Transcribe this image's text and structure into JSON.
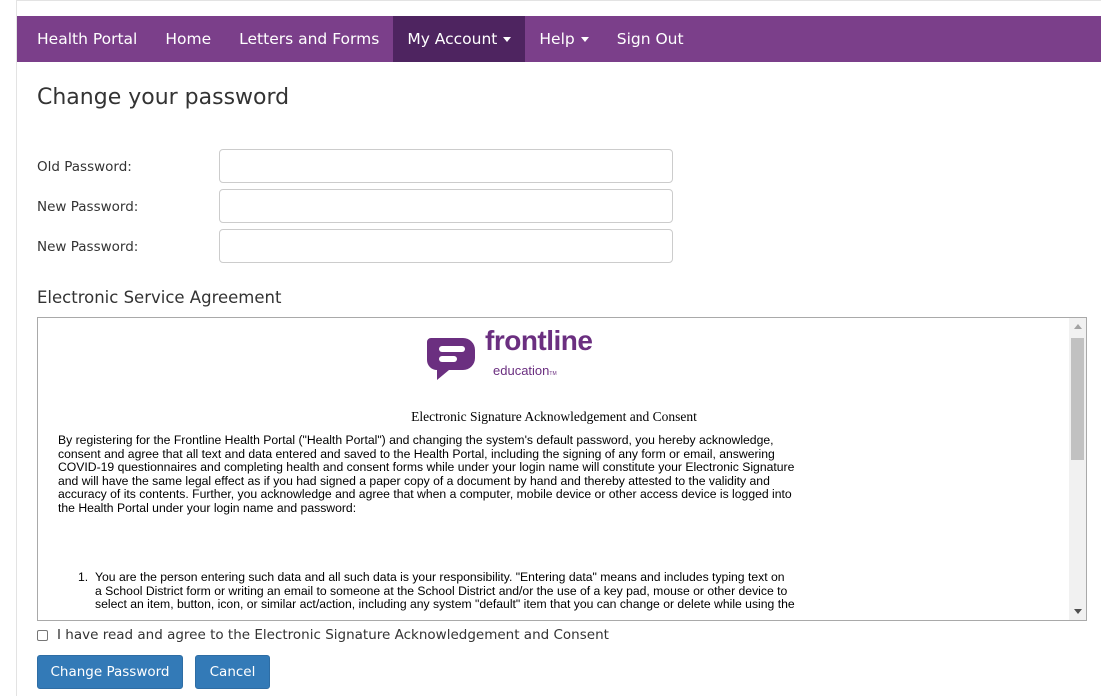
{
  "navbar": {
    "brand": "Health Portal",
    "items": [
      {
        "label": "Home"
      },
      {
        "label": "Letters and Forms"
      },
      {
        "label": "My Account"
      },
      {
        "label": "Help"
      },
      {
        "label": "Sign Out"
      }
    ],
    "color": "#7b3f8a",
    "active_color": "#4e2460"
  },
  "page": {
    "title": "Change your password"
  },
  "form": {
    "old_password_label": "Old Password:",
    "new_password_label": "New Password:",
    "confirm_password_label": "New Password:",
    "old_password_value": "",
    "new_password_value": "",
    "confirm_password_value": ""
  },
  "agreement": {
    "section_title": "Electronic Service Agreement",
    "logo_word": "frontline",
    "logo_sub": "education",
    "logo_tm": "TM",
    "logo_color": "#6b2f80",
    "heading": "Electronic Signature Acknowledgement and Consent",
    "paragraph_lines": [
      "By registering for the Frontline Health Portal (\"Health Portal\") and changing the system's default password, you hereby acknowledge,",
      "consent and agree that all text and data entered and saved to the Health Portal, including the signing of any form or email, answering",
      "COVID-19 questionnaires and completing health and consent forms while under your login name will constitute your Electronic Signature",
      "and will have the same legal effect as if you had signed a paper copy of a document by hand and thereby attested to the validity and",
      "accuracy of its contents. Further, you acknowledge and agree that when a computer, mobile device or other access device is logged into",
      "the Health Portal under your login name and password:"
    ],
    "list_item_number": "1.",
    "list_item_lines": [
      "You are the person entering such data and all such data is your responsibility.  \"Entering data\" means and includes typing text on",
      "a School District form or writing an email to someone at the School District and/or the use of a key pad, mouse or other device to",
      "select an item, button, icon, or similar act/action, including any system \"default\" item that you can change or delete while using the"
    ]
  },
  "consent": {
    "label": "I have read and agree to the Electronic Signature Acknowledgement and Consent",
    "checked": false
  },
  "buttons": {
    "change_password": "Change Password",
    "cancel": "Cancel",
    "primary_color": "#337ab7"
  }
}
